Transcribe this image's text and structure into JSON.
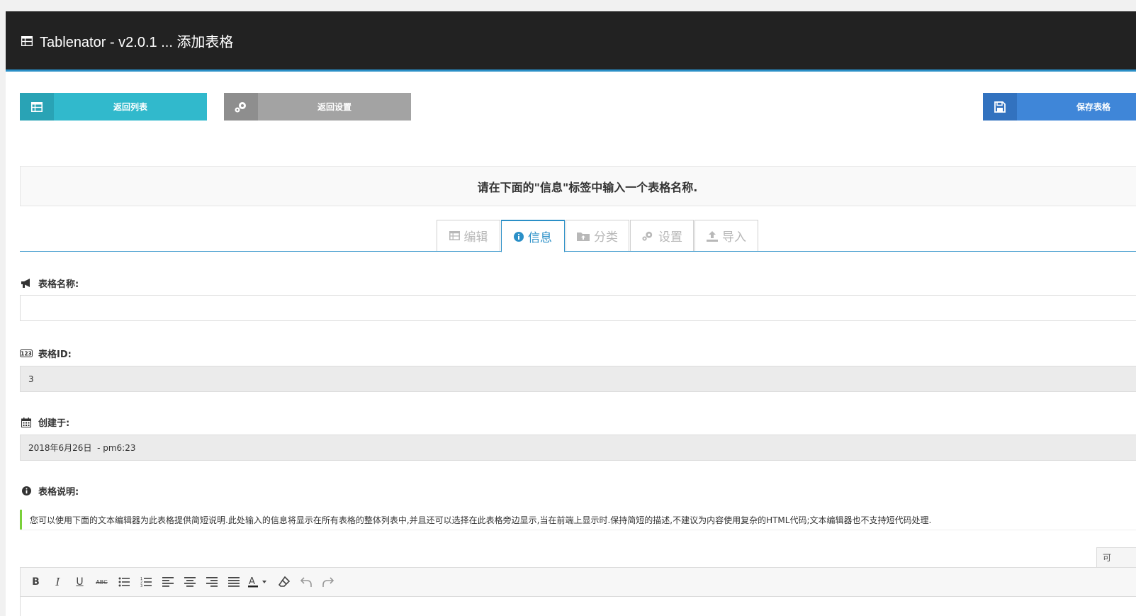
{
  "header": {
    "title": "Tablenator - v2.0.1 ... 添加表格",
    "icon": "table-icon"
  },
  "buttons": {
    "back_list": "返回列表",
    "back_settings": "返回设置",
    "save_table": "保存表格"
  },
  "notice": "请在下面的\"信息\"标签中输入一个表格名称.",
  "tabs": [
    {
      "label": "编辑",
      "icon": "table-icon"
    },
    {
      "label": "信息",
      "icon": "info-icon",
      "active": true
    },
    {
      "label": "分类",
      "icon": "folder-icon"
    },
    {
      "label": "设置",
      "icon": "gears-icon"
    },
    {
      "label": "导入",
      "icon": "upload-icon"
    }
  ],
  "fields": {
    "name_label": "表格名称:",
    "name_value": "",
    "id_label": "表格ID:",
    "id_value": "3",
    "created_label": "创建于:",
    "created_value": "2018年6月26日  - pm6:23",
    "desc_label": "表格说明:"
  },
  "description_note": "您可以使用下面的文本编辑器为此表格提供简短说明.此处输入的信息将显示在所有表格的整体列表中,并且还可以选择在此表格旁边显示,当在前端上显示时.保持简短的描述,不建议为内容使用复杂的HTML代码;文本编辑器也不支持短代码处理.",
  "editor": {
    "mode_tab": "可",
    "toolbar": [
      "B",
      "I",
      "U",
      "ABC",
      "bullet-list",
      "numbered-list",
      "align-left",
      "align-center",
      "align-right",
      "justify",
      "text-color",
      "clear-format",
      "undo",
      "redo"
    ]
  },
  "colors": {
    "titlebar": "#222222",
    "accent": "#2a8fc7",
    "btn_list": "#31b9cc",
    "btn_settings": "#a3a3a3",
    "btn_save": "#3f86d8",
    "note_border": "#7ad03a"
  }
}
